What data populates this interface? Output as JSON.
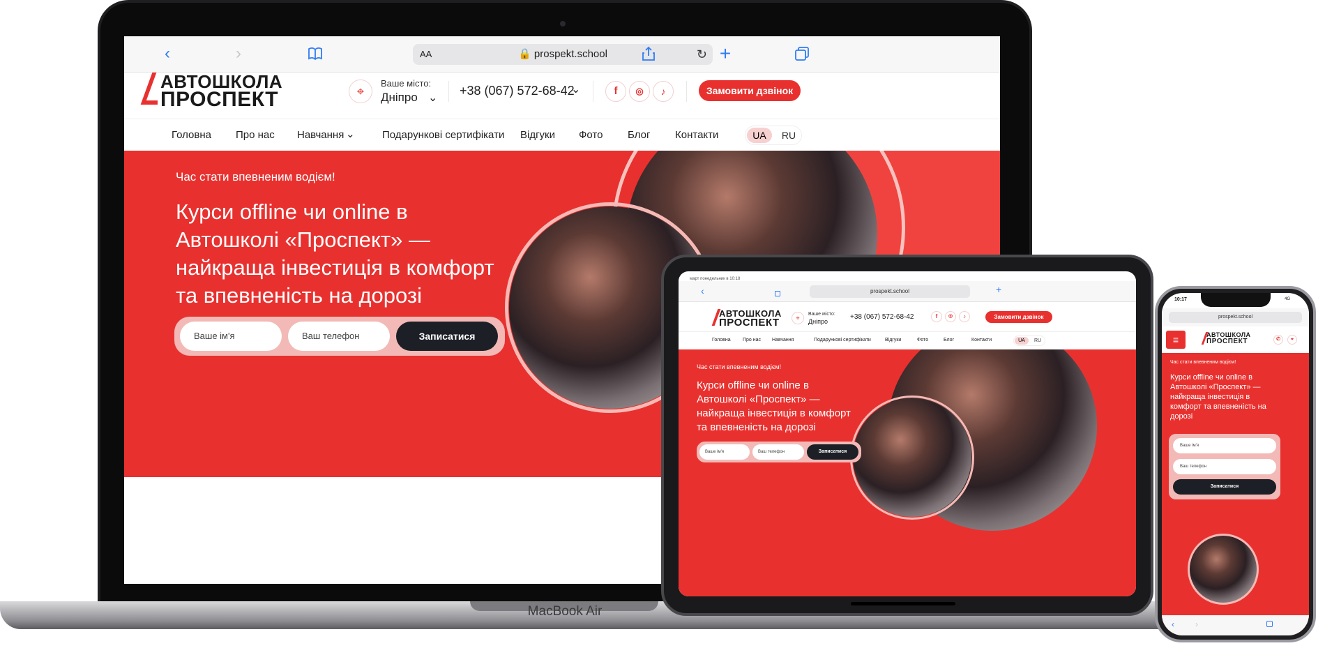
{
  "browser": {
    "url": "prospekt.school",
    "text_size": "AA"
  },
  "site": {
    "logo_line1": "АВТОШКОЛА",
    "logo_line2": "ПРОСПЕКТ",
    "city_label": "Ваше місто:",
    "city_value": "Дніпро",
    "phone": "+38 (067) 572-68-42",
    "call_button": "Замовити дзвінок",
    "nav": [
      "Головна",
      "Про нас",
      "Навчання",
      "Подарункові сертифікати",
      "Відгуки",
      "Фото",
      "Блог",
      "Контакти"
    ],
    "lang_ua": "UA",
    "lang_ru": "RU"
  },
  "hero": {
    "tagline": "Час стати впевненим водієм!",
    "headline_1": "Курси offline чи online в",
    "headline_2": "Автошколі «Проспект» —",
    "headline_3": "найкраща інвестиція в комфорт",
    "headline_4": "та впевненість на дорозі",
    "name_placeholder": "Ваше ім'я",
    "phone_placeholder": "Ваш телефон",
    "submit": "Записатися"
  },
  "tablet": {
    "status_time": "март понедельник в 10:18",
    "name_placeholder": "Ваше ім'я",
    "phone_placeholder": "Ваш телефон"
  },
  "phone": {
    "status_time": "10:17",
    "network": "4G",
    "headline_1": "Курси offline чи online в",
    "headline_2": "Автошколі «Проспект» —",
    "headline_3": "найкраща інвестиція в",
    "headline_4": "комфорт та впевненість на",
    "headline_5": "дорозі"
  },
  "device_label": "MacBook Air",
  "colors": {
    "brand_red": "#e8312f",
    "dark_button": "#1c1f26",
    "link_blue": "#2f7cf6"
  }
}
